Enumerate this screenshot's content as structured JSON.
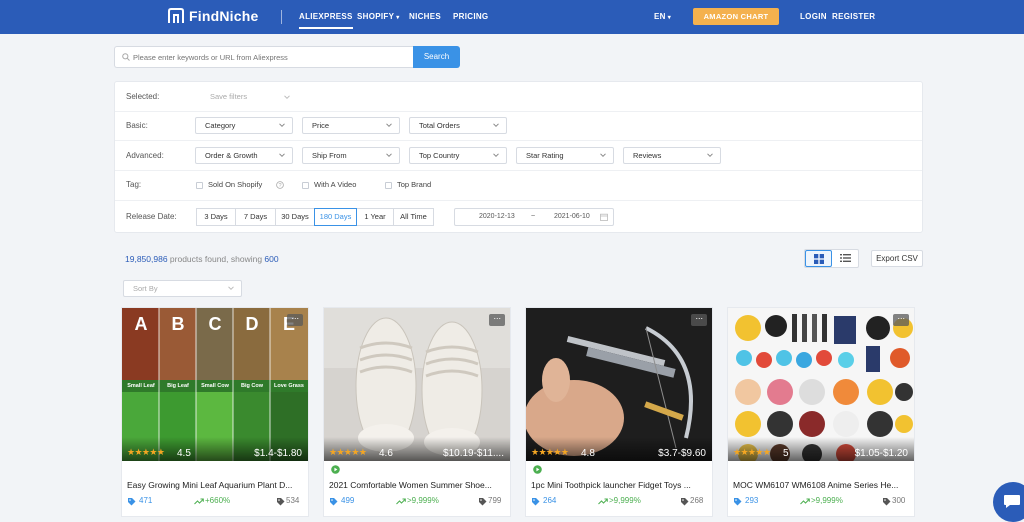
{
  "header": {
    "logo": "FindNiche",
    "nav": [
      {
        "label": "ALIEXPRESS",
        "active": true
      },
      {
        "label": "SHOPIFY",
        "dropdown": true
      },
      {
        "label": "NICHES"
      },
      {
        "label": "PRICING"
      }
    ],
    "language": "EN",
    "amazon_button": "AMAZON CHART",
    "login": "LOGIN",
    "register": "REGISTER"
  },
  "search": {
    "placeholder": "Please enter keywords or URL from Aliexpress",
    "button": "Search"
  },
  "filters": {
    "selected_label": "Selected:",
    "save_filters": "Save filters",
    "basic_label": "Basic:",
    "basic": [
      "Category",
      "Price",
      "Total Orders"
    ],
    "advanced_label": "Advanced:",
    "advanced": [
      "Order & Growth",
      "Ship From",
      "Top Country",
      "Star Rating",
      "Reviews"
    ],
    "tag_label": "Tag:",
    "tags": [
      "Sold On Shopify",
      "With A Video",
      "Top Brand"
    ],
    "release_label": "Release Date:",
    "release_ranges": [
      "3 Days",
      "7 Days",
      "30 Days",
      "180 Days",
      "1 Year",
      "All Time"
    ],
    "release_selected": "180 Days",
    "date_from": "2020-12-13",
    "date_sep": "~",
    "date_to": "2021-06-10"
  },
  "results": {
    "count": "19,850,986",
    "middle_text": " products found, showing ",
    "showing": "600",
    "export": "Export CSV",
    "sort_placeholder": "Sort By",
    "view_mode": "grid"
  },
  "products": [
    {
      "title": "Easy Growing Mini Leaf Aquarium Plant D...",
      "rating": "4.5",
      "price": "$1.4-$1.80",
      "orders": "471",
      "growth": "+660%",
      "reviews": "534",
      "has_video": false,
      "panel_letters": [
        "A",
        "B",
        "C",
        "D",
        "E"
      ],
      "panel_labels": [
        "Small Leaf",
        "Big Leaf",
        "Small Cow",
        "Big Cow",
        "Love Grass"
      ]
    },
    {
      "title": "2021 Comfortable Women Summer Shoe...",
      "rating": "4.6",
      "price": "$10.19-$11....",
      "orders": "499",
      "growth": ">9,999%",
      "reviews": "799",
      "has_video": true
    },
    {
      "title": "1pc Mini Toothpick launcher Fidget Toys ...",
      "rating": "4.8",
      "price": "$3.7-$9.60",
      "orders": "264",
      "growth": ">9,999%",
      "reviews": "268",
      "has_video": true
    },
    {
      "title": "MOC WM6107 WM6108 Anime Series He...",
      "rating": "5",
      "price": "$1.05-$1.20",
      "orders": "293",
      "growth": ">9,999%",
      "reviews": "300",
      "has_video": false
    }
  ],
  "colors": {
    "header_bg": "#2b5cb8",
    "accent": "#3a92e6",
    "amazon": "#f4b14e",
    "growth": "#4caf50",
    "star": "#f4a623"
  },
  "icons": [
    "logo-icon",
    "search-icon",
    "chevron-down-icon",
    "help-icon",
    "calendar-icon",
    "grid-view-icon",
    "list-view-icon",
    "more-icon",
    "video-icon",
    "orders-tag-icon",
    "trend-up-icon",
    "reviews-tag-icon",
    "chat-icon"
  ]
}
